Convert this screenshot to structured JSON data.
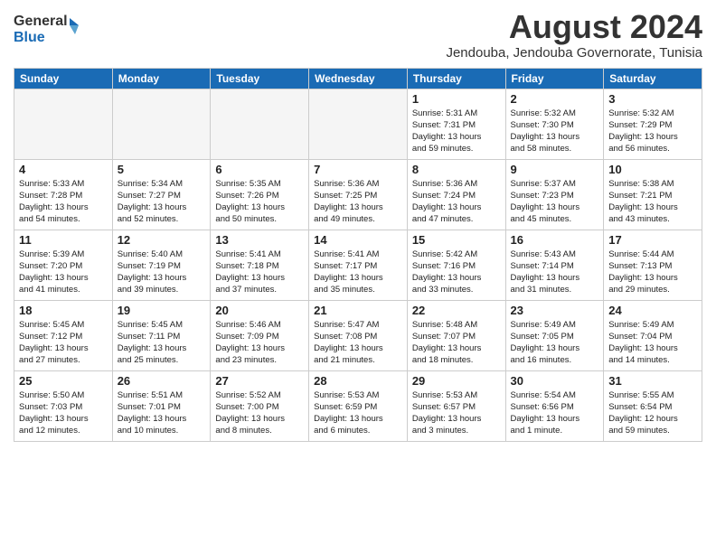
{
  "logo": {
    "line1": "General",
    "line2": "Blue"
  },
  "header": {
    "month_year": "August 2024",
    "location": "Jendouba, Jendouba Governorate, Tunisia"
  },
  "weekdays": [
    "Sunday",
    "Monday",
    "Tuesday",
    "Wednesday",
    "Thursday",
    "Friday",
    "Saturday"
  ],
  "weeks": [
    [
      {
        "day": "",
        "info": ""
      },
      {
        "day": "",
        "info": ""
      },
      {
        "day": "",
        "info": ""
      },
      {
        "day": "",
        "info": ""
      },
      {
        "day": "1",
        "info": "Sunrise: 5:31 AM\nSunset: 7:31 PM\nDaylight: 13 hours\nand 59 minutes."
      },
      {
        "day": "2",
        "info": "Sunrise: 5:32 AM\nSunset: 7:30 PM\nDaylight: 13 hours\nand 58 minutes."
      },
      {
        "day": "3",
        "info": "Sunrise: 5:32 AM\nSunset: 7:29 PM\nDaylight: 13 hours\nand 56 minutes."
      }
    ],
    [
      {
        "day": "4",
        "info": "Sunrise: 5:33 AM\nSunset: 7:28 PM\nDaylight: 13 hours\nand 54 minutes."
      },
      {
        "day": "5",
        "info": "Sunrise: 5:34 AM\nSunset: 7:27 PM\nDaylight: 13 hours\nand 52 minutes."
      },
      {
        "day": "6",
        "info": "Sunrise: 5:35 AM\nSunset: 7:26 PM\nDaylight: 13 hours\nand 50 minutes."
      },
      {
        "day": "7",
        "info": "Sunrise: 5:36 AM\nSunset: 7:25 PM\nDaylight: 13 hours\nand 49 minutes."
      },
      {
        "day": "8",
        "info": "Sunrise: 5:36 AM\nSunset: 7:24 PM\nDaylight: 13 hours\nand 47 minutes."
      },
      {
        "day": "9",
        "info": "Sunrise: 5:37 AM\nSunset: 7:23 PM\nDaylight: 13 hours\nand 45 minutes."
      },
      {
        "day": "10",
        "info": "Sunrise: 5:38 AM\nSunset: 7:21 PM\nDaylight: 13 hours\nand 43 minutes."
      }
    ],
    [
      {
        "day": "11",
        "info": "Sunrise: 5:39 AM\nSunset: 7:20 PM\nDaylight: 13 hours\nand 41 minutes."
      },
      {
        "day": "12",
        "info": "Sunrise: 5:40 AM\nSunset: 7:19 PM\nDaylight: 13 hours\nand 39 minutes."
      },
      {
        "day": "13",
        "info": "Sunrise: 5:41 AM\nSunset: 7:18 PM\nDaylight: 13 hours\nand 37 minutes."
      },
      {
        "day": "14",
        "info": "Sunrise: 5:41 AM\nSunset: 7:17 PM\nDaylight: 13 hours\nand 35 minutes."
      },
      {
        "day": "15",
        "info": "Sunrise: 5:42 AM\nSunset: 7:16 PM\nDaylight: 13 hours\nand 33 minutes."
      },
      {
        "day": "16",
        "info": "Sunrise: 5:43 AM\nSunset: 7:14 PM\nDaylight: 13 hours\nand 31 minutes."
      },
      {
        "day": "17",
        "info": "Sunrise: 5:44 AM\nSunset: 7:13 PM\nDaylight: 13 hours\nand 29 minutes."
      }
    ],
    [
      {
        "day": "18",
        "info": "Sunrise: 5:45 AM\nSunset: 7:12 PM\nDaylight: 13 hours\nand 27 minutes."
      },
      {
        "day": "19",
        "info": "Sunrise: 5:45 AM\nSunset: 7:11 PM\nDaylight: 13 hours\nand 25 minutes."
      },
      {
        "day": "20",
        "info": "Sunrise: 5:46 AM\nSunset: 7:09 PM\nDaylight: 13 hours\nand 23 minutes."
      },
      {
        "day": "21",
        "info": "Sunrise: 5:47 AM\nSunset: 7:08 PM\nDaylight: 13 hours\nand 21 minutes."
      },
      {
        "day": "22",
        "info": "Sunrise: 5:48 AM\nSunset: 7:07 PM\nDaylight: 13 hours\nand 18 minutes."
      },
      {
        "day": "23",
        "info": "Sunrise: 5:49 AM\nSunset: 7:05 PM\nDaylight: 13 hours\nand 16 minutes."
      },
      {
        "day": "24",
        "info": "Sunrise: 5:49 AM\nSunset: 7:04 PM\nDaylight: 13 hours\nand 14 minutes."
      }
    ],
    [
      {
        "day": "25",
        "info": "Sunrise: 5:50 AM\nSunset: 7:03 PM\nDaylight: 13 hours\nand 12 minutes."
      },
      {
        "day": "26",
        "info": "Sunrise: 5:51 AM\nSunset: 7:01 PM\nDaylight: 13 hours\nand 10 minutes."
      },
      {
        "day": "27",
        "info": "Sunrise: 5:52 AM\nSunset: 7:00 PM\nDaylight: 13 hours\nand 8 minutes."
      },
      {
        "day": "28",
        "info": "Sunrise: 5:53 AM\nSunset: 6:59 PM\nDaylight: 13 hours\nand 6 minutes."
      },
      {
        "day": "29",
        "info": "Sunrise: 5:53 AM\nSunset: 6:57 PM\nDaylight: 13 hours\nand 3 minutes."
      },
      {
        "day": "30",
        "info": "Sunrise: 5:54 AM\nSunset: 6:56 PM\nDaylight: 13 hours\nand 1 minute."
      },
      {
        "day": "31",
        "info": "Sunrise: 5:55 AM\nSunset: 6:54 PM\nDaylight: 12 hours\nand 59 minutes."
      }
    ]
  ]
}
